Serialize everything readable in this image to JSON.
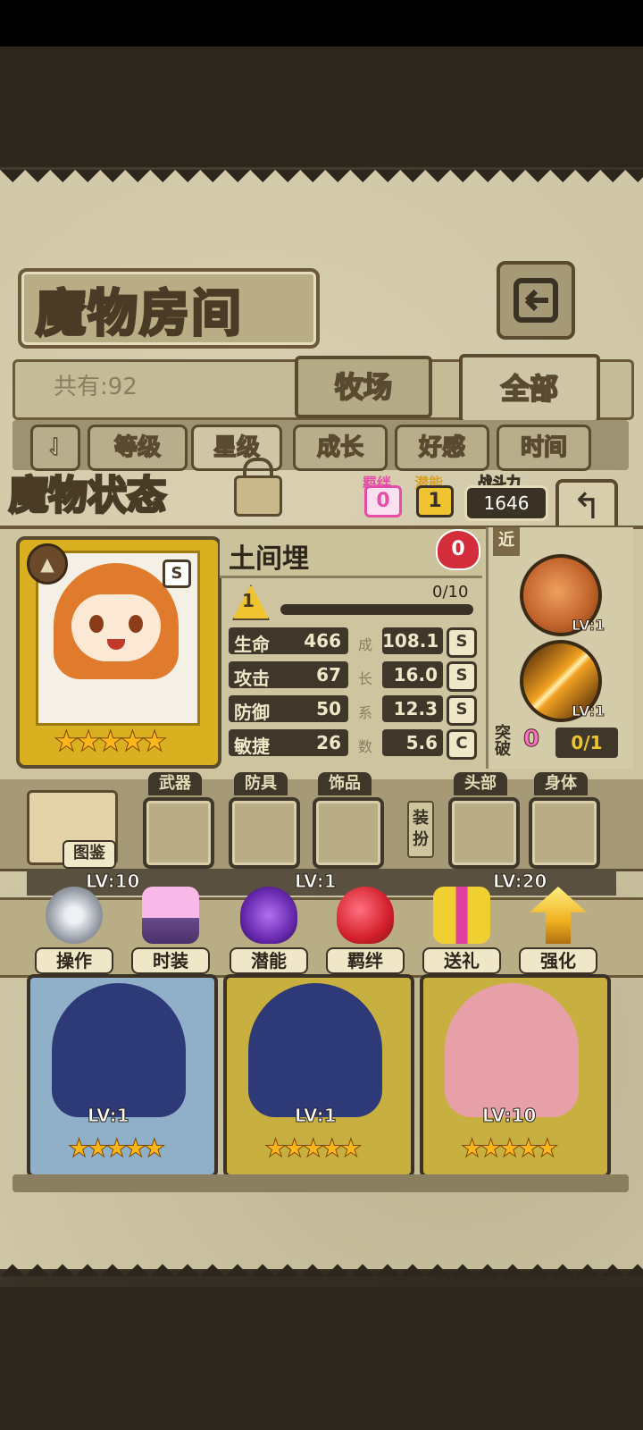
{
  "header": {
    "title": "魔物房间",
    "count_text": "共有:92"
  },
  "tabs": [
    {
      "label": "牧场"
    },
    {
      "label": "全部"
    }
  ],
  "sort_buttons": [
    {
      "label": "等级"
    },
    {
      "label": "星级"
    },
    {
      "label": "成长"
    },
    {
      "label": "好感"
    },
    {
      "label": "时间"
    }
  ],
  "status": {
    "title": "魔物状态",
    "bond_label": "羁绊",
    "bond_value": "0",
    "potential_label": "潜能",
    "potential_value": "1",
    "power_label": "战斗力",
    "power_value": "1646"
  },
  "monster": {
    "name": "土间埋",
    "rarity": "S",
    "stars": "★★★★★",
    "heart_value": "0",
    "level": "1",
    "xp": "0/10",
    "xp_fraction": 0.0,
    "stats": [
      {
        "label": "生命",
        "value": "466",
        "growth": "108.1",
        "grade": "S"
      },
      {
        "label": "攻击",
        "value": "67",
        "growth": "16.0",
        "grade": "S"
      },
      {
        "label": "防御",
        "value": "50",
        "growth": "12.3",
        "grade": "S"
      },
      {
        "label": "敏捷",
        "value": "26",
        "growth": "5.6",
        "grade": "C"
      }
    ],
    "growth_vertical": [
      "成",
      "长",
      "系",
      "数"
    ],
    "range_tag": "近",
    "skills": [
      {
        "lv": "LV:1"
      },
      {
        "lv": "LV:1"
      }
    ],
    "breakthrough_label": "突破",
    "breakthrough_value": "0",
    "breakthrough_progress": "0/1"
  },
  "equipment": {
    "book_label": "图鉴",
    "slots": [
      {
        "label": "武器"
      },
      {
        "label": "防具"
      },
      {
        "label": "饰品"
      },
      {
        "label": "头部"
      },
      {
        "label": "身体"
      }
    ],
    "side_label": "装扮"
  },
  "card_row_top_levels": [
    "LV:10",
    "LV:1",
    "LV:20"
  ],
  "actions": [
    {
      "label": "操作"
    },
    {
      "label": "时装"
    },
    {
      "label": "潜能"
    },
    {
      "label": "羁绊"
    },
    {
      "label": "送礼"
    },
    {
      "label": "强化"
    }
  ],
  "cards": [
    {
      "lv": "LV:1",
      "stars": "★★★★★"
    },
    {
      "lv": "LV:1",
      "stars": "★★★★★"
    },
    {
      "lv": "LV:10",
      "stars": "★★★★★"
    }
  ],
  "colors": {
    "parchment": "#cfc6a5",
    "dark_brown": "#3f372a",
    "gold": "#d9b020",
    "star": "#ffb61a",
    "pink": "#ff6ec7"
  }
}
